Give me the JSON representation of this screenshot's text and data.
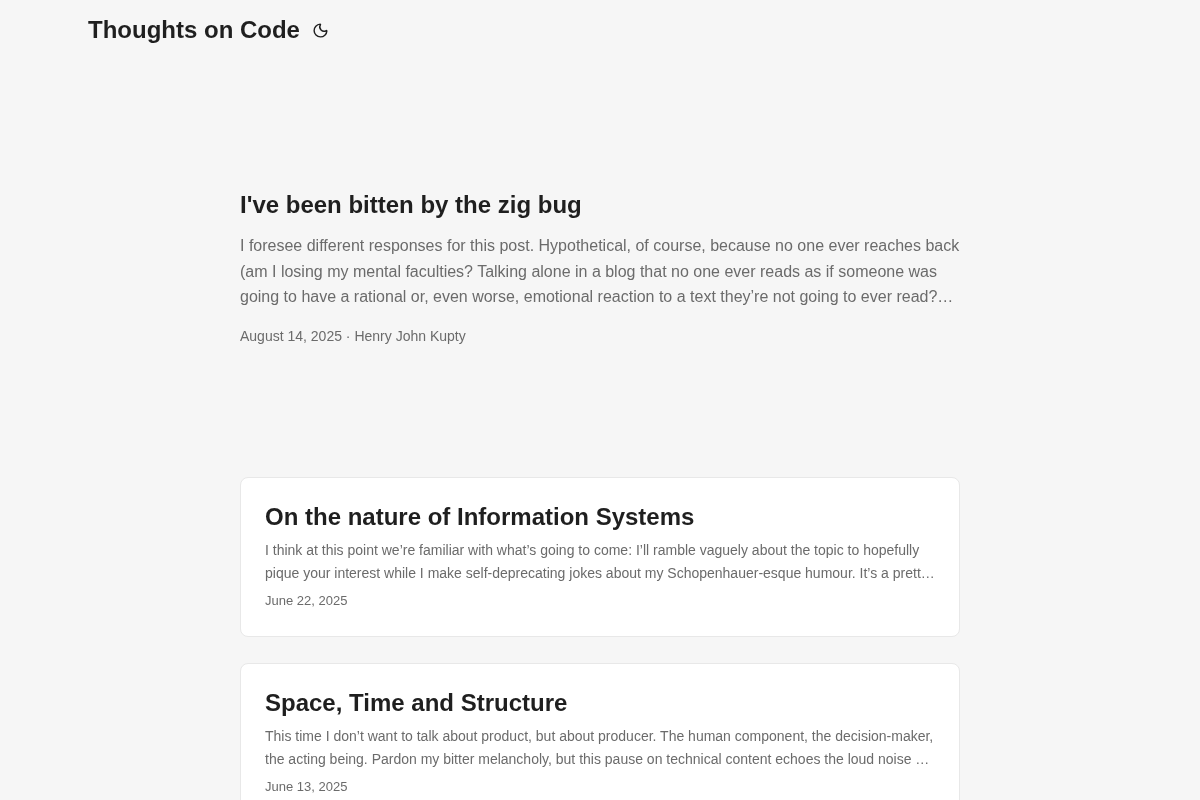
{
  "site": {
    "title": "Thoughts on Code"
  },
  "featured": {
    "title": "I've been bitten by the zig bug",
    "excerpt": "I foresee different responses for this post. Hypothetical, of course, because no one ever reaches back (am I losing my mental faculties? Talking alone in a blog that no one ever reads as if someone was going to have a rational or, even worse, emotional reaction to a text they’re not going to ever read?…",
    "meta": "August 14, 2025 · Henry John Kupty"
  },
  "posts": [
    {
      "title": "On the nature of Information Systems",
      "excerpt": "I think at this point we’re familiar with what’s going to come: I’ll ramble vaguely about the topic to hopefully pique your interest while I make self-deprecating jokes about my Schopenhauer-esque humour. It’s a prett…",
      "date": "June 22, 2025"
    },
    {
      "title": "Space, Time and Structure",
      "excerpt": "This time I don’t want to talk about product, but about producer. The human component, the decision-maker, the acting being. Pardon my bitter melancholy, but this pause on technical content echoes the loud noise …",
      "date": "June 13, 2025"
    }
  ]
}
